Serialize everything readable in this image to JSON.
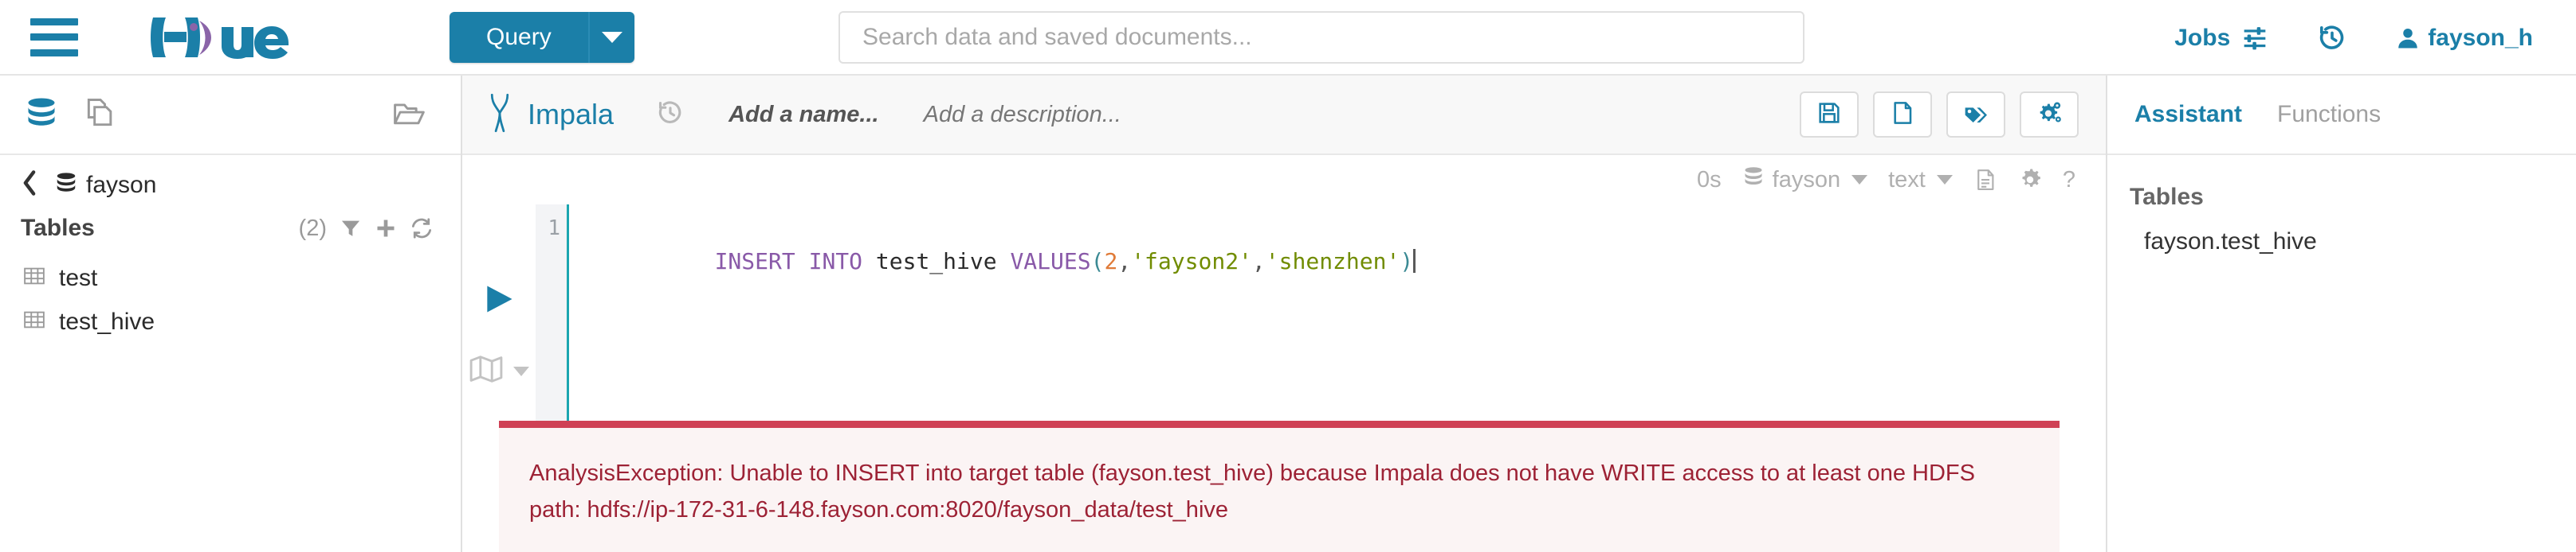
{
  "topbar": {
    "hamburger_name": "menu-icon",
    "logo_text": "hue",
    "query_button": "Query",
    "search_placeholder": "Search data and saved documents...",
    "search_value": "",
    "jobs_label": "Jobs",
    "history_icon": "history-icon",
    "user_label": "fayson_h"
  },
  "sidebar": {
    "head_icons": [
      "database-icon",
      "documents-icon",
      "open-folder-icon"
    ],
    "breadcrumb": {
      "back": "chevron-left-icon",
      "db_icon": "database-icon",
      "label": "fayson"
    },
    "tables_title": "Tables",
    "tables_count": "(2)",
    "tables_actions": [
      "filter-icon",
      "plus-icon",
      "refresh-icon"
    ],
    "tables": [
      {
        "icon": "table-icon",
        "label": "test"
      },
      {
        "icon": "table-icon",
        "label": "test_hive"
      }
    ]
  },
  "editor": {
    "engine": "Impala",
    "engine_icon": "impala-icon",
    "history_icon": "history-icon",
    "name_placeholder": "Add a name...",
    "description_placeholder": "Add a description...",
    "actions": [
      {
        "name": "save-button",
        "icon": "save-icon"
      },
      {
        "name": "new-query-button",
        "icon": "new-file-icon"
      },
      {
        "name": "tags-button",
        "icon": "tags-icon"
      },
      {
        "name": "settings-button",
        "icon": "gears-icon"
      }
    ],
    "toolbar": {
      "elapsed": "0s",
      "database": "fayson",
      "result_format": "text",
      "icons": [
        "result-doc-icon",
        "gear-icon",
        "help-icon"
      ],
      "help_label": "?"
    },
    "run_button": "run-query-icon",
    "lower_button": "map-icon",
    "line_number": "1",
    "sql": {
      "tokens": [
        {
          "t": "INSERT INTO ",
          "c": "k"
        },
        {
          "t": "test_hive ",
          "c": "id"
        },
        {
          "t": "VALUES",
          "c": "k"
        },
        {
          "t": "(",
          "c": "p"
        },
        {
          "t": "2",
          "c": "n"
        },
        {
          "t": ",",
          "c": "pl"
        },
        {
          "t": "'fayson2'",
          "c": "s"
        },
        {
          "t": ",",
          "c": "pl"
        },
        {
          "t": "'shenzhen'",
          "c": "s"
        },
        {
          "t": ")",
          "c": "p"
        }
      ],
      "plain": "INSERT INTO test_hive VALUES(2,'fayson2','shenzhen')"
    },
    "error": "AnalysisException: Unable to INSERT into target table (fayson.test_hive) because Impala does not have WRITE access to at least one HDFS path: hdfs://ip-172-31-6-148.fayson.com:8020/fayson_data/test_hive"
  },
  "assistant": {
    "tabs": [
      {
        "label": "Assistant",
        "active": true
      },
      {
        "label": "Functions",
        "active": false
      }
    ],
    "section_title": "Tables",
    "items": [
      {
        "label": "fayson.test_hive"
      }
    ]
  },
  "colors": {
    "brand_blue": "#1b7fa8",
    "logo_purple": "#8a64a8",
    "error_red": "#9d2235",
    "error_border": "#cf4155",
    "error_bg": "#fbf4f4",
    "keyword_purple": "#8959a8",
    "string_green": "#718c00",
    "number_orange": "#e07b39",
    "active_line": "#1ba6b0"
  }
}
